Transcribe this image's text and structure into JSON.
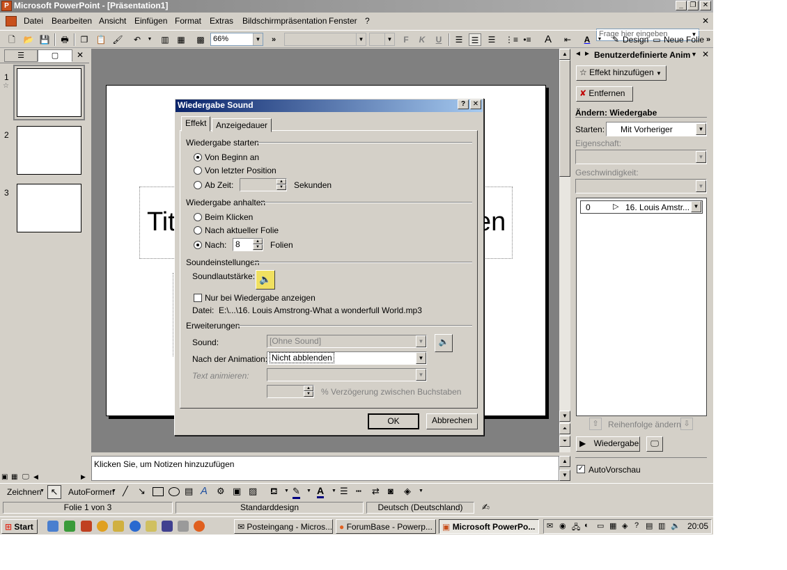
{
  "window": {
    "title": "Microsoft PowerPoint - [Präsentation1]",
    "app_icon": "P"
  },
  "menu": {
    "items": [
      "Datei",
      "Bearbeiten",
      "Ansicht",
      "Einfügen",
      "Format",
      "Extras",
      "Bildschirmpräsentation",
      "Fenster",
      "?"
    ],
    "help_placeholder": "Frage hier eingeben"
  },
  "toolbar": {
    "zoom": "66%",
    "bold": "F",
    "italic": "K",
    "underline": "U",
    "design_label": "Design",
    "new_slide_label": "Neue Folie"
  },
  "slides": [
    {
      "number": "1"
    },
    {
      "number": "2"
    },
    {
      "number": "3"
    }
  ],
  "slide": {
    "title_left": "Tit",
    "title_right": "en"
  },
  "notes": {
    "placeholder": "Klicken Sie, um Notizen hinzuzufügen"
  },
  "taskpane": {
    "title": "Benutzerdefinierte Anim",
    "add_effect": "Effekt hinzufügen",
    "remove": "Entfernen",
    "change_heading": "Ändern: Wiedergabe",
    "start_label": "Starten:",
    "start_value": "Mit Vorheriger",
    "property_label": "Eigenschaft:",
    "speed_label": "Geschwindigkeit:",
    "list_item_index": "0",
    "list_item_name": "16. Louis Amstr...",
    "reorder_label": "Reihenfolge ändern",
    "play_label": "Wiedergabe",
    "autopreview_label": "AutoVorschau"
  },
  "dialog": {
    "title": "Wiedergabe Sound",
    "tabs": [
      "Effekt",
      "Anzeigedauer"
    ],
    "start_group": "Wiedergabe starten",
    "start_options": [
      "Von Beginn an",
      "Von letzter Position",
      "Ab Zeit:"
    ],
    "seconds_label": "Sekunden",
    "stop_group": "Wiedergabe anhalten",
    "stop_options": [
      "Beim Klicken",
      "Nach aktueller Folie",
      "Nach:"
    ],
    "after_value": "8",
    "slides_label": "Folien",
    "sound_group": "Soundeinstellungen",
    "volume_label": "Soundlautstärke:",
    "hide_label": "Nur bei Wiedergabe anzeigen",
    "file_label": "Datei:",
    "file_path": "E:\\...\\16. Louis Amstrong-What a wonderfull World.mp3",
    "ext_group": "Erweiterungen",
    "sound_label": "Sound:",
    "sound_value": "[Ohne Sound]",
    "after_anim_label": "Nach der Animation:",
    "after_anim_value": "Nicht abblenden",
    "animate_text_label": "Text animieren:",
    "delay_label": "% Verzögerung zwischen Buchstaben",
    "ok": "OK",
    "cancel": "Abbrechen"
  },
  "drawbar": {
    "draw_label": "Zeichnen",
    "autoshapes_label": "AutoFormen"
  },
  "status": {
    "slide": "Folie 1 von 3",
    "design": "Standarddesign",
    "language": "Deutsch (Deutschland)"
  },
  "taskbar": {
    "start": "Start",
    "tasks": [
      "Posteingang - Micros...",
      "ForumBase - Powerp...",
      "Microsoft PowerPo..."
    ],
    "clock": "20:05"
  },
  "colors": {
    "dialog_title": "#0a246a",
    "face": "#d4d0c8"
  }
}
